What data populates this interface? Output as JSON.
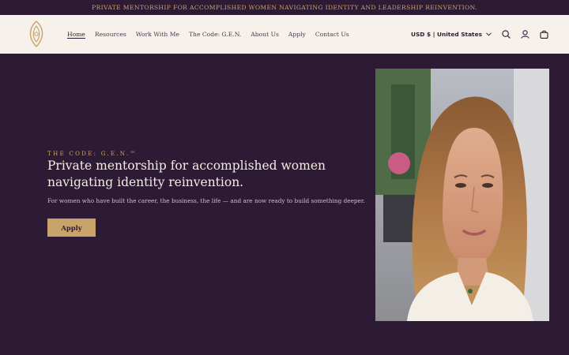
{
  "announcement": "PRIVATE MENTORSHIP FOR ACCOMPLISHED WOMEN NAVIGATING IDENTITY AND LEADERSHIP REINVENTION.",
  "nav": {
    "items": [
      {
        "label": "Home",
        "active": true
      },
      {
        "label": "Resources"
      },
      {
        "label": "Work With Me"
      },
      {
        "label": "The Code: G.E.N."
      },
      {
        "label": "About Us"
      },
      {
        "label": "Apply"
      },
      {
        "label": "Contact Us"
      }
    ]
  },
  "header": {
    "currency": "USD $ | United States",
    "icons": [
      "search-icon",
      "account-icon",
      "cart-icon"
    ]
  },
  "hero": {
    "eyebrow": "THE CODE: G.E.N.™",
    "headline": "Private mentorship for accomplished women navigating identity reinvention.",
    "subtext": "For women who have built the career, the business, the life — and are now ready to build something deeper.",
    "cta_label": "Apply"
  },
  "colors": {
    "background": "#2d1b35",
    "header_bg": "#f6f1ea",
    "accent_gold": "#c9a46a",
    "text_light": "#f4ece2"
  }
}
